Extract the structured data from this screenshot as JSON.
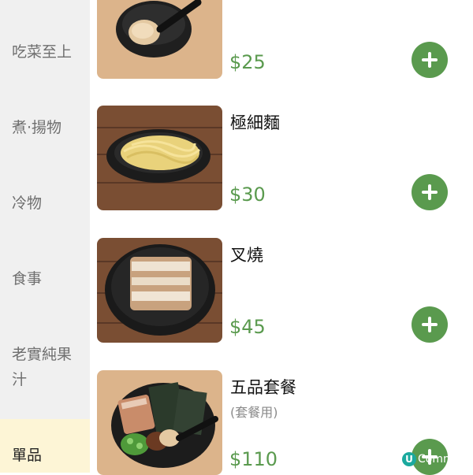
{
  "sidebar": {
    "categories": [
      {
        "label": "吃菜至上"
      },
      {
        "label": "煮·揚物"
      },
      {
        "label": "冷物"
      },
      {
        "label": "食事"
      },
      {
        "label": "老實純果汁"
      },
      {
        "label": "單品"
      }
    ]
  },
  "menu": {
    "items": [
      {
        "name": "",
        "subtitle": "",
        "price": "$25",
        "image_icon": "egg-bowl-icon"
      },
      {
        "name": "極細麵",
        "subtitle": "",
        "price": "$30",
        "image_icon": "noodles-icon"
      },
      {
        "name": "叉燒",
        "subtitle": "",
        "price": "$45",
        "image_icon": "chashu-icon"
      },
      {
        "name": "五品套餐",
        "subtitle": "(套餐用)",
        "price": "$110",
        "image_icon": "topping-set-icon"
      }
    ]
  },
  "watermark": {
    "badge": "U",
    "text": "Comm"
  },
  "colors": {
    "sidebar_bg": "#f0f0f0",
    "active_category_bg": "#fdf5d6",
    "accent_green": "#5a9a4e"
  }
}
